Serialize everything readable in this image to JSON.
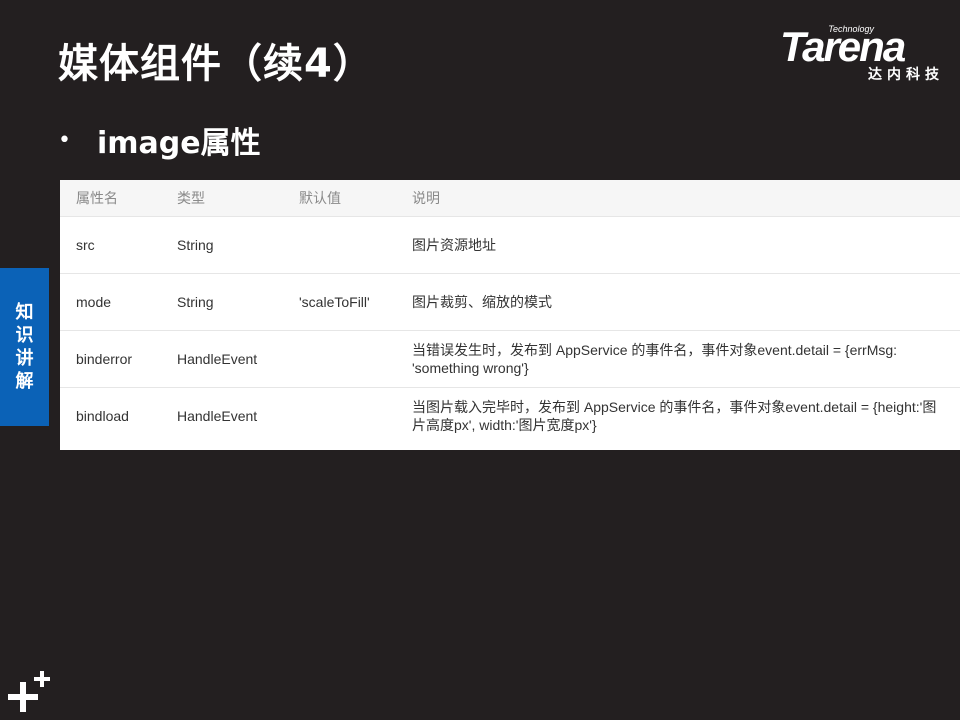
{
  "slide": {
    "title": "媒体组件（续4）",
    "bullet": "image属性",
    "side_tab": [
      "知",
      "识",
      "讲",
      "解"
    ]
  },
  "logo": {
    "technology": "Technology",
    "brand": "Tarena",
    "chinese": "达内科技"
  },
  "table": {
    "headers": [
      "属性名",
      "类型",
      "默认值",
      "说明"
    ],
    "rows": [
      {
        "name": "src",
        "type": "String",
        "default": "",
        "desc": "图片资源地址"
      },
      {
        "name": "mode",
        "type": "String",
        "default": "'scaleToFill'",
        "desc": "图片裁剪、缩放的模式"
      },
      {
        "name": "binderror",
        "type": "HandleEvent",
        "default": "",
        "desc": "当错误发生时，发布到 AppService 的事件名，事件对象event.detail = {errMsg: 'something wrong'}"
      },
      {
        "name": "bindload",
        "type": "HandleEvent",
        "default": "",
        "desc": "当图片载入完毕时，发布到 AppService 的事件名，事件对象event.detail = {height:'图片高度px', width:'图片宽度px'}"
      }
    ]
  },
  "colors": {
    "background": "#231f20",
    "side_tab": "#0b62b7",
    "table_bg": "#ffffff",
    "header_text": "#8a8a8a"
  },
  "icons": {
    "corner_mark": "plus-sparkle-icon"
  }
}
